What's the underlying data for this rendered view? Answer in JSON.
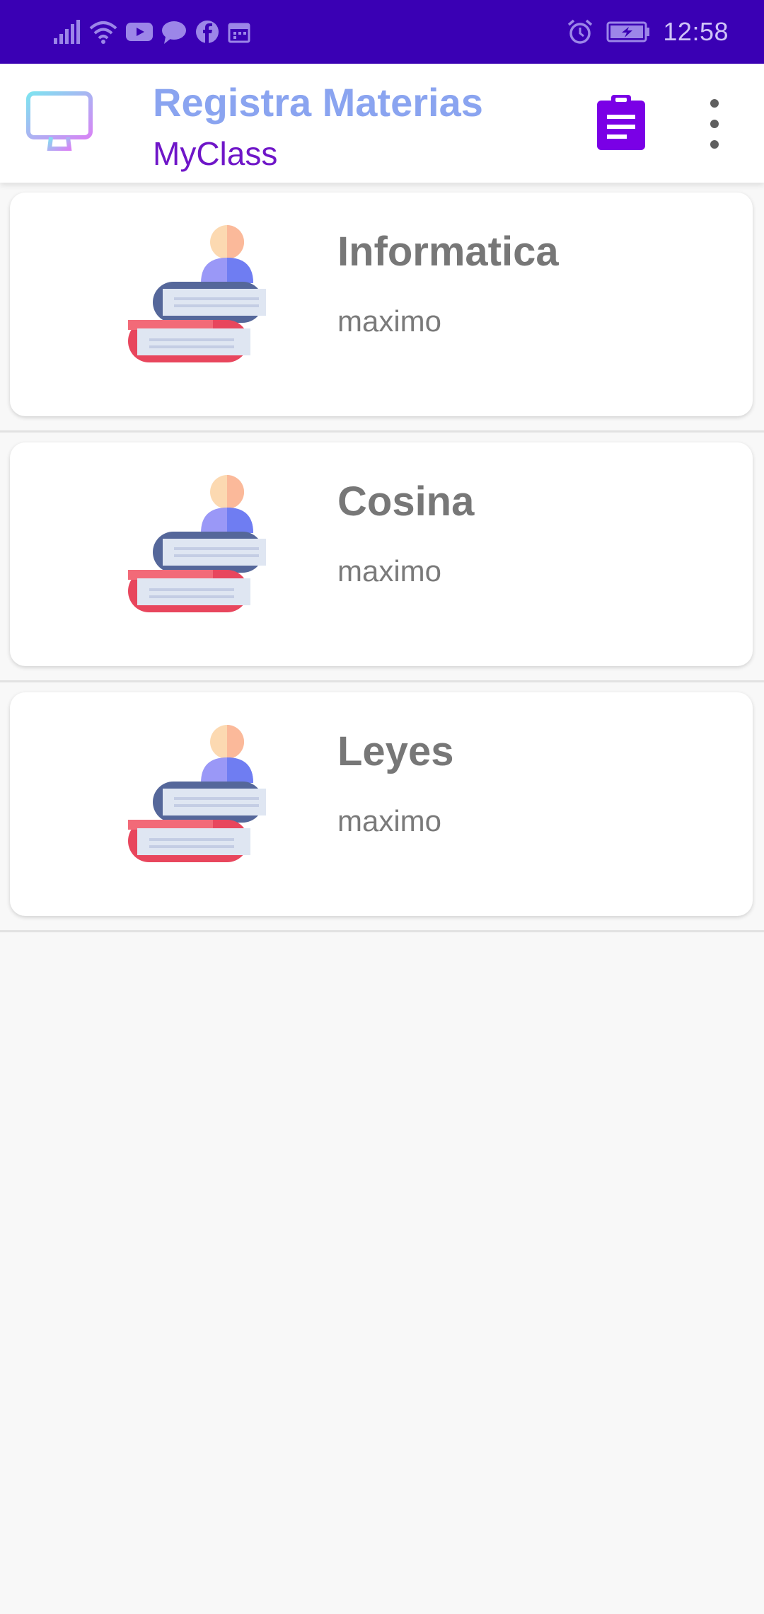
{
  "status_bar": {
    "time": "12:58",
    "left_icons": [
      "signal-icon",
      "wifi-icon",
      "youtube-icon",
      "chat-icon",
      "facebook-icon",
      "calendar-icon"
    ],
    "right_icons": [
      "alarm-icon",
      "battery-charging-icon"
    ]
  },
  "app_bar": {
    "title": "Registra Materias",
    "subtitle": "MyClass",
    "logo_icon": "monitor-icon",
    "action_icon": "clipboard-icon",
    "overflow_icon": "more-vert-icon",
    "colors": {
      "title": "#8aa4f0",
      "subtitle": "#6f16c8",
      "action": "#7a00e6",
      "status_bar": "#3a00b4"
    }
  },
  "subjects": [
    {
      "title": "Informatica",
      "teacher": "maximo",
      "icon": "books-student-icon"
    },
    {
      "title": "Cosina",
      "teacher": "maximo",
      "icon": "books-student-icon"
    },
    {
      "title": "Leyes",
      "teacher": "maximo",
      "icon": "books-student-icon"
    }
  ]
}
